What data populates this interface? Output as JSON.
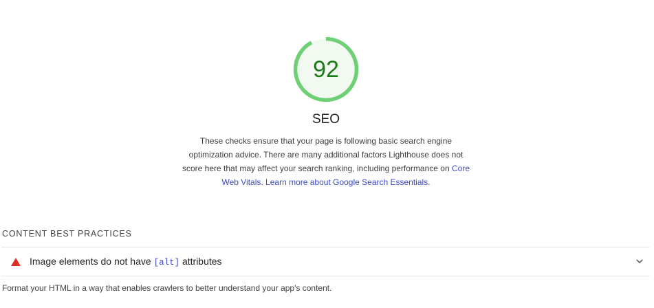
{
  "category": {
    "score": "92",
    "score_fraction": 0.92,
    "title": "SEO",
    "description_text": "These checks ensure that your page is following basic search engine optimization advice. There are many additional factors Lighthouse does not score here that may affect your search ranking, including performance on ",
    "link_core_web_vitals": "Core Web Vitals",
    "link_separator": ". ",
    "link_search_essentials": "Learn more about Google Search Essentials",
    "description_end": "."
  },
  "group": {
    "title": "CONTENT BEST PRACTICES",
    "description": "Format your HTML in a way that enables crawlers to better understand your app's content."
  },
  "audits": [
    {
      "title_prefix": "Image elements do not have ",
      "code": "[alt]",
      "title_suffix": " attributes",
      "status_icon": "warning-triangle-icon"
    }
  ],
  "colors": {
    "gauge_ring": "#6fcf74",
    "gauge_fill": "#f1f9f1",
    "score_text": "#1b7a14",
    "link": "#3b49c4",
    "fail_icon": "#d93025"
  }
}
